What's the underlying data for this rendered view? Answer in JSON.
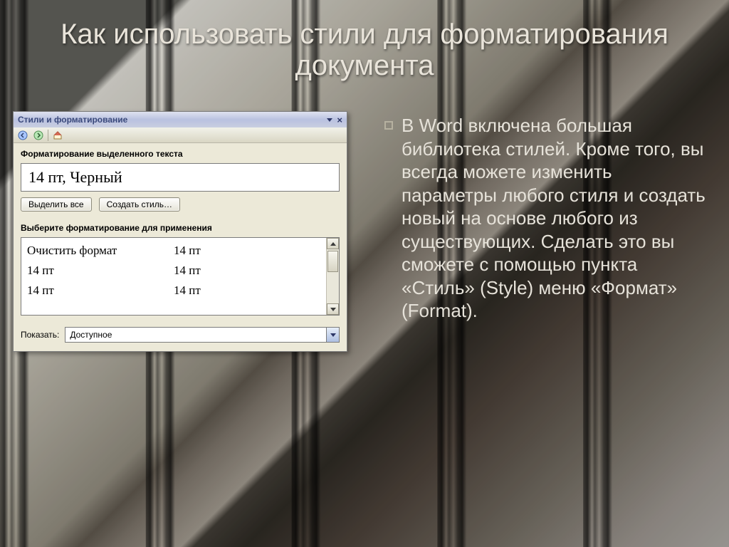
{
  "slide": {
    "title": "Как использовать стили для форматирования документа",
    "body": "В Word включена большая библиотека стилей. Кроме того, вы всегда можете изменить параметры любого стиля и создать новый на основе любого из существующих. Сделать это вы сможете с помощью пункта «Стиль» (Style) меню «Формат» (Format)."
  },
  "pane": {
    "title": "Стили и форматирование",
    "section_current": "Форматирование выделенного текста",
    "current_style": "14 пт, Черный",
    "buttons": {
      "select_all": "Выделить все",
      "new_style": "Создать стиль…"
    },
    "section_list": "Выберите форматирование для применения",
    "list": [
      {
        "left": "Очистить формат",
        "right": "14 пт"
      },
      {
        "left": "14 пт",
        "right": "14 пт"
      },
      {
        "left": "14 пт",
        "right": "14 пт"
      }
    ],
    "show_label": "Показать:",
    "show_value": "Доступное"
  }
}
